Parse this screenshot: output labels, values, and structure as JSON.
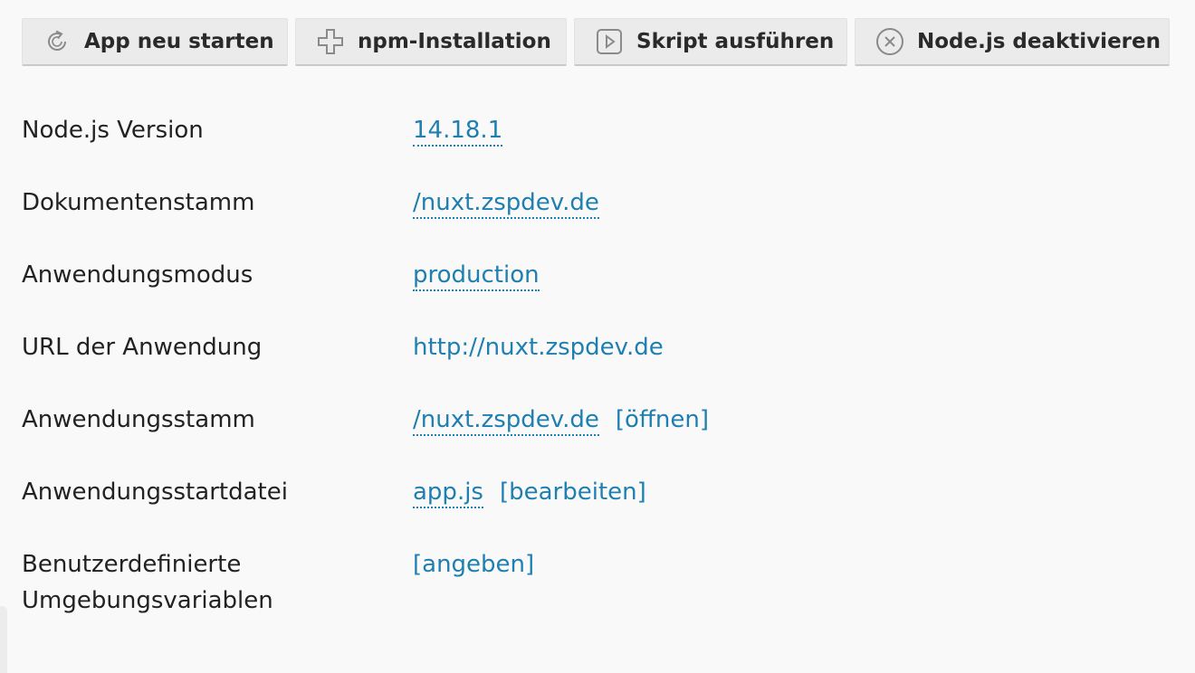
{
  "toolbar": {
    "buttons": [
      {
        "label": "App neu starten",
        "icon": "restart-icon"
      },
      {
        "label": "npm-Installation",
        "icon": "plus-icon"
      },
      {
        "label": "Skript ausführen",
        "icon": "play-icon"
      },
      {
        "label": "Node.js deaktivieren",
        "icon": "close-circle-icon"
      }
    ]
  },
  "details": {
    "nodejs_version": {
      "label": "Node.js Version",
      "value": "14.18.1"
    },
    "document_root": {
      "label": "Dokumentenstamm",
      "value": "/nuxt.zspdev.de"
    },
    "app_mode": {
      "label": "Anwendungsmodus",
      "value": "production"
    },
    "app_url": {
      "label": "URL der Anwendung",
      "value": "http://nuxt.zspdev.de"
    },
    "app_root": {
      "label": "Anwendungsstamm",
      "value": "/nuxt.zspdev.de",
      "action": "[öffnen]"
    },
    "startup_file": {
      "label": "Anwendungsstartdatei",
      "value": "app.js",
      "action": "[bearbeiten]"
    },
    "env_vars": {
      "label_line1": "Benutzerdefinierte",
      "label_line2": "Umgebungsvariablen",
      "action": "[angeben]"
    }
  },
  "colors": {
    "link": "#1f7fb1",
    "button_bg": "#ebebeb",
    "text": "#222222",
    "page_bg": "#f9f9f9"
  }
}
